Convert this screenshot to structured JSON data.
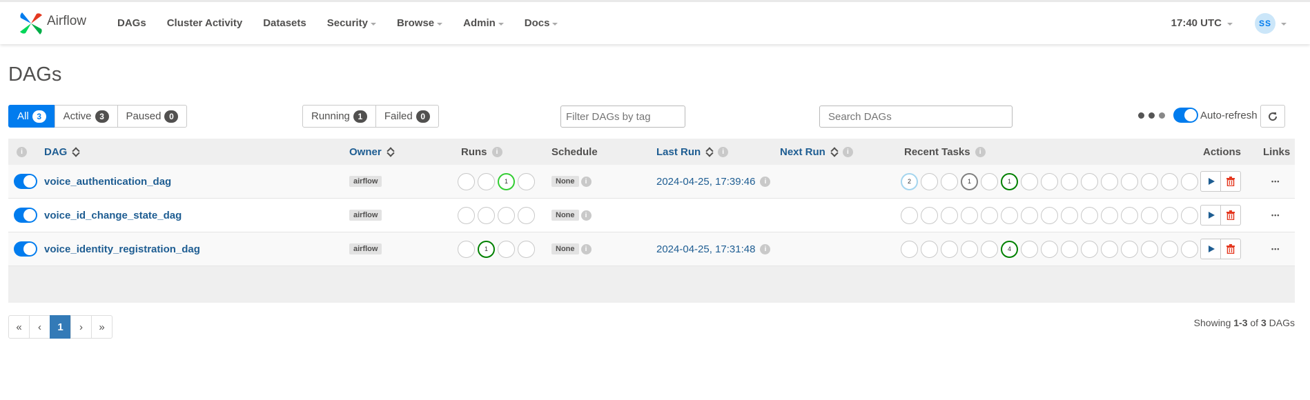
{
  "brand": {
    "name": "Airflow"
  },
  "nav": {
    "items": [
      {
        "label": "DAGs",
        "caret": false
      },
      {
        "label": "Cluster Activity",
        "caret": false
      },
      {
        "label": "Datasets",
        "caret": false
      },
      {
        "label": "Security",
        "caret": true
      },
      {
        "label": "Browse",
        "caret": true
      },
      {
        "label": "Admin",
        "caret": true
      },
      {
        "label": "Docs",
        "caret": true
      }
    ],
    "clock": "17:40 UTC",
    "avatar_initials": "SS"
  },
  "page_title": "DAGs",
  "status_filters": [
    {
      "label": "All",
      "count": "3",
      "active": true
    },
    {
      "label": "Active",
      "count": "3",
      "active": false
    },
    {
      "label": "Paused",
      "count": "0",
      "active": false
    }
  ],
  "run_filters": [
    {
      "label": "Running",
      "count": "1"
    },
    {
      "label": "Failed",
      "count": "0"
    }
  ],
  "tag_filter": {
    "placeholder": "Filter DAGs by tag"
  },
  "search": {
    "placeholder": "Search DAGs"
  },
  "auto_refresh": {
    "label": "Auto-refresh",
    "enabled": true
  },
  "table": {
    "headers": {
      "dag": "DAG",
      "owner": "Owner",
      "runs": "Runs",
      "schedule": "Schedule",
      "last_run": "Last Run",
      "next_run": "Next Run",
      "recent_tasks": "Recent Tasks",
      "actions": "Actions",
      "links": "Links"
    },
    "rows": [
      {
        "dag_id": "voice_authentication_dag",
        "owner": "airflow",
        "runs": [
          "",
          "",
          "1",
          ""
        ],
        "runs_state": [
          "",
          "",
          "running",
          ""
        ],
        "schedule": "None",
        "last_run": "2024-04-25, 17:39:46",
        "next_run": "",
        "recent_tasks": [
          "2",
          "",
          "",
          "1",
          "",
          "1",
          "",
          "",
          "",
          "",
          "",
          "",
          "",
          "",
          ""
        ],
        "recent_tasks_state": [
          "scheduled",
          "",
          "",
          "queued",
          "",
          "success",
          "",
          "",
          "",
          "",
          "",
          "",
          "",
          "",
          ""
        ]
      },
      {
        "dag_id": "voice_id_change_state_dag",
        "owner": "airflow",
        "runs": [
          "",
          "",
          "",
          ""
        ],
        "runs_state": [
          "",
          "",
          "",
          ""
        ],
        "schedule": "None",
        "last_run": "",
        "next_run": "",
        "recent_tasks": [
          "",
          "",
          "",
          "",
          "",
          "",
          "",
          "",
          "",
          "",
          "",
          "",
          "",
          "",
          ""
        ],
        "recent_tasks_state": [
          "",
          "",
          "",
          "",
          "",
          "",
          "",
          "",
          "",
          "",
          "",
          "",
          "",
          "",
          ""
        ]
      },
      {
        "dag_id": "voice_identity_registration_dag",
        "owner": "airflow",
        "runs": [
          "",
          "1",
          "",
          ""
        ],
        "runs_state": [
          "",
          "success",
          "",
          ""
        ],
        "schedule": "None",
        "last_run": "2024-04-25, 17:31:48",
        "next_run": "",
        "recent_tasks": [
          "",
          "",
          "",
          "",
          "",
          "4",
          "",
          "",
          "",
          "",
          "",
          "",
          "",
          "",
          ""
        ],
        "recent_tasks_state": [
          "",
          "",
          "",
          "",
          "",
          "success",
          "",
          "",
          "",
          "",
          "",
          "",
          "",
          "",
          ""
        ]
      }
    ]
  },
  "pagination": {
    "first": "«",
    "prev": "‹",
    "current": "1",
    "next": "›",
    "last": "»"
  },
  "showing": {
    "prefix": "Showing",
    "range": "1-3",
    "of": "of",
    "total": "3",
    "suffix": "DAGs"
  },
  "colors": {
    "primary": "#017cee",
    "link": "#1e5d92",
    "running": "#32cd32",
    "success": "#008000",
    "queued": "#808080",
    "scheduled": "#a4d5ee",
    "delete": "#e43921"
  },
  "icons": {
    "logo": "pinwheel-logo-icon",
    "refresh": "refresh-icon",
    "trigger": "play-icon",
    "delete": "trash-icon",
    "links": "ellipsis-icon",
    "info": "info-icon"
  }
}
